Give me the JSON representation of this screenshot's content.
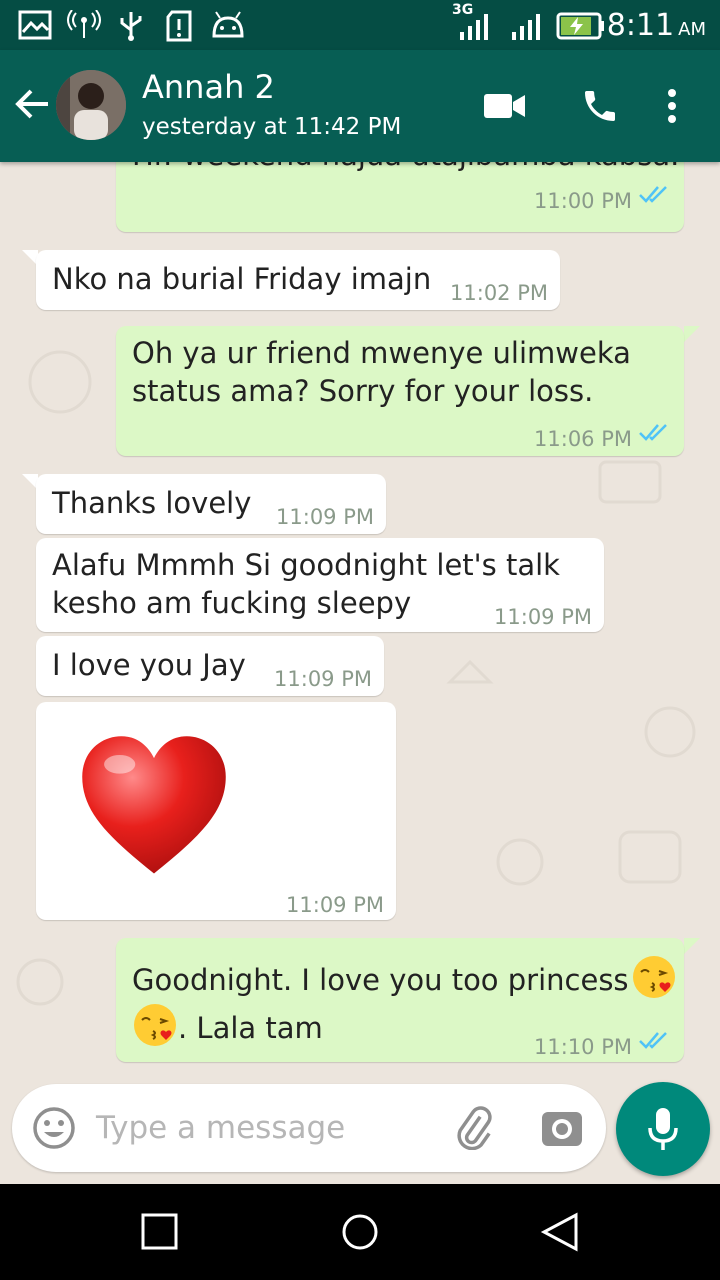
{
  "status_bar": {
    "network": "3G",
    "time": "8:11",
    "ampm": "AM"
  },
  "header": {
    "contact_name": "Annah 2",
    "last_seen": "yesterday at 11:42 PM"
  },
  "messages": [
    {
      "text": "Hi! weekend hajua utajibamba kabsa.",
      "time": "11:00 PM"
    },
    {
      "text": "Nko na burial Friday imajn",
      "time": "11:02 PM"
    },
    {
      "text_line1": "Oh ya ur friend mwenye ulimweka",
      "text_line2": "status ama?  Sorry for your loss.",
      "time": "11:06 PM"
    },
    {
      "text": "Thanks lovely",
      "time": "11:09 PM"
    },
    {
      "text_line1": "Alafu Mmmh Si goodnight let's talk",
      "text_line2": "kesho am fucking sleepy",
      "time": "11:09 PM"
    },
    {
      "text": "I love you Jay",
      "time": "11:09 PM"
    },
    {
      "emoji": "heart",
      "time": "11:09 PM"
    },
    {
      "text_line1": "Goodnight. I love you too princess",
      "text_line2": ".  Lala tam",
      "time": "11:10 PM"
    }
  ],
  "composer": {
    "placeholder": "Type a message"
  },
  "colors": {
    "header": "#075e54",
    "status_bar": "#054d44",
    "outgoing": "#dcf8c6",
    "incoming": "#ffffff",
    "accent": "#00897b",
    "read_ticks": "#4fc3f7"
  }
}
